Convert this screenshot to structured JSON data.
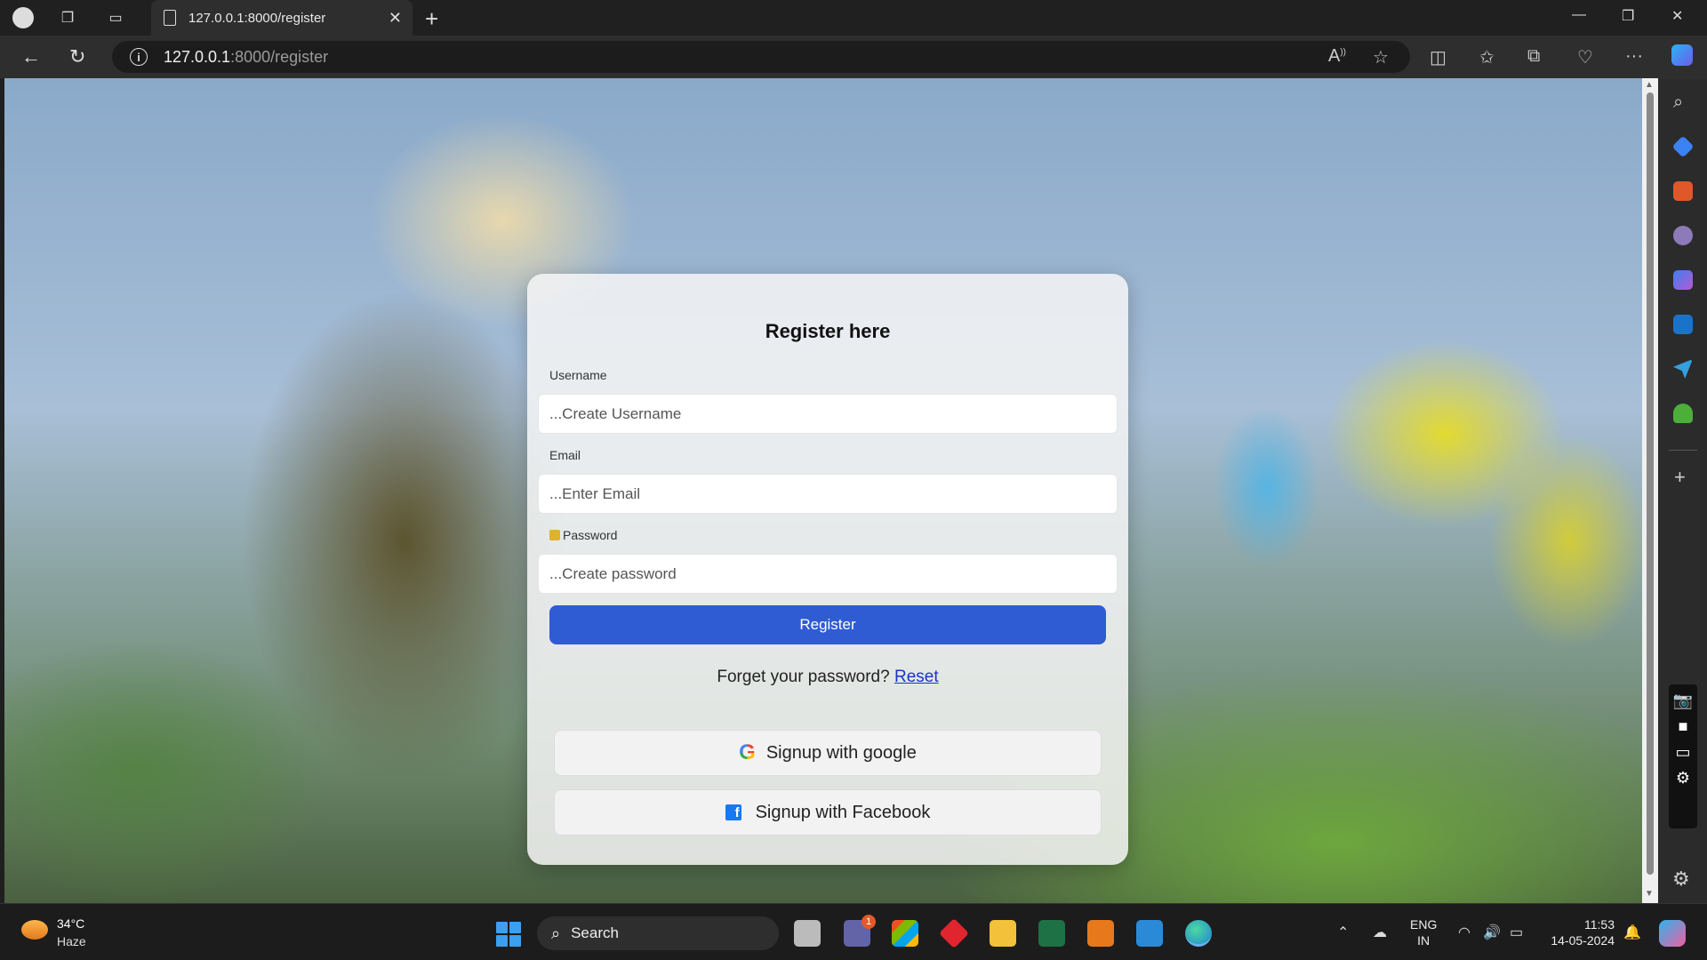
{
  "browser": {
    "tab_title": "127.0.0.1:8000/register",
    "url_host": "127.0.0.1",
    "url_path": ":8000/register"
  },
  "form": {
    "title": "Register here",
    "username_label": "Username",
    "username_placeholder": "...Create Username",
    "email_label": "Email",
    "email_placeholder": "...Enter Email",
    "password_label": "Password",
    "password_placeholder": "...Create password",
    "register_label": "Register",
    "forgot_text": "Forget your password?",
    "reset_link": "Reset",
    "google_label": "Signup with google",
    "facebook_label": "Signup with Facebook"
  },
  "taskbar": {
    "temperature": "34°C",
    "weather": "Haze",
    "search_label": "Search",
    "teams_badge": "1",
    "lang_line1": "ENG",
    "lang_line2": "IN",
    "time": "11:53",
    "date": "14-05-2024"
  },
  "colors": {
    "register_button": "#2f5bd3",
    "reset_link": "#1a33c9"
  }
}
